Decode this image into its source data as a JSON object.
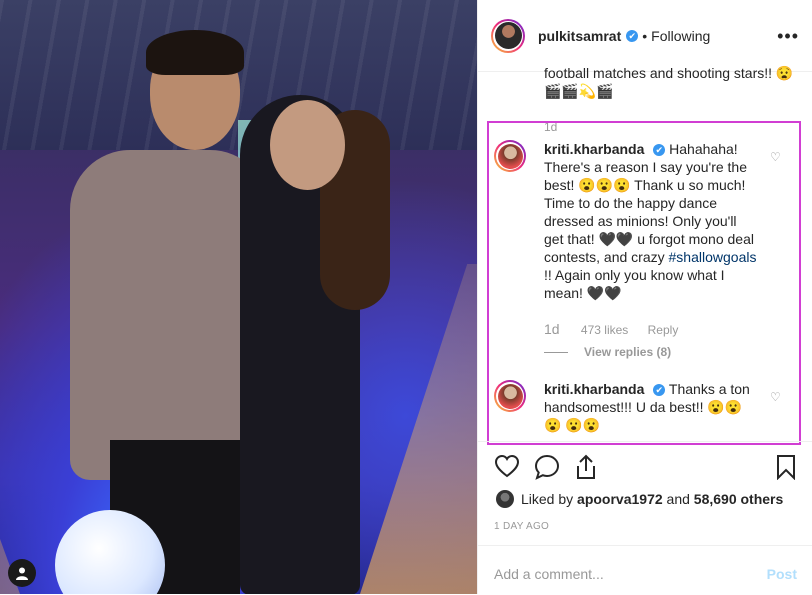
{
  "post": {
    "username": "pulkitsamrat",
    "verified_mark": "✔",
    "follow_state": "Following",
    "more_label": "•••"
  },
  "previous_comment": {
    "text": "football matches and shooting stars!! 😧🎬🎬💫🎬",
    "time": "1d"
  },
  "comments": [
    {
      "username": "kriti.kharbanda",
      "verified_mark": "✔",
      "text_a": "Hahahaha! There's a reason I say you're the best! 😮😮😮 Thank u so much! Time to do the happy dance dressed as minions! Only you'll get that! 🖤🖤 u forgot mono deal contests, and crazy ",
      "hashtag": "#shallowgoals",
      "text_b": " !! Again only you know what I mean! 🖤🖤",
      "time": "1d",
      "likes": "473 likes",
      "reply": "Reply",
      "view_replies": "View replies (8)"
    },
    {
      "username": "kriti.kharbanda",
      "verified_mark": "✔",
      "text_a": "Thanks a ton handsomest!!! U da best!! 😮😮😮 😮😮"
    }
  ],
  "likes": {
    "prefix": "Liked by",
    "user": "apoorva1972",
    "and": "and",
    "count": "58,690 others"
  },
  "time_ago": "1 DAY AGO",
  "add_comment": {
    "placeholder": "Add a comment...",
    "post_label": "Post"
  },
  "colors": {
    "highlight_border": "#d13ed3",
    "verified": "#3897f0",
    "hashtag": "#003569",
    "post_disabled": "#b2dffc"
  },
  "icons": [
    "heart-icon",
    "comment-icon",
    "share-icon",
    "bookmark-icon",
    "user-tag-icon",
    "more-icon",
    "verified-icon"
  ]
}
